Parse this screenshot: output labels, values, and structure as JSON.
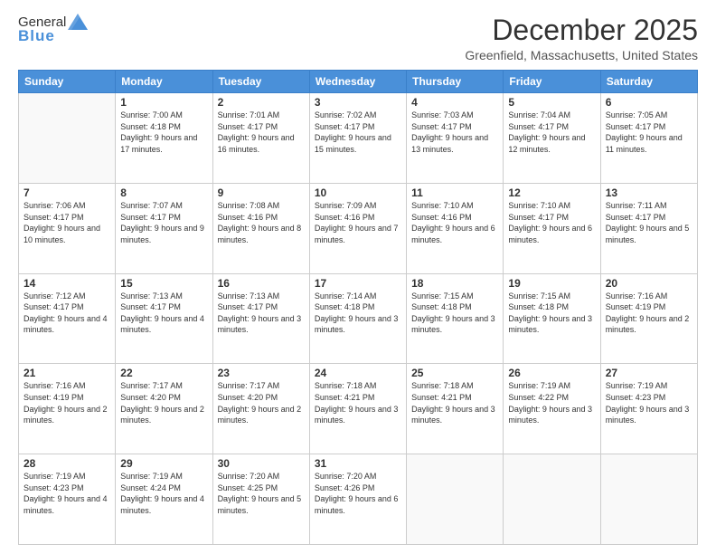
{
  "logo": {
    "general": "General",
    "blue": "Blue"
  },
  "header": {
    "month": "December 2025",
    "location": "Greenfield, Massachusetts, United States"
  },
  "weekdays": [
    "Sunday",
    "Monday",
    "Tuesday",
    "Wednesday",
    "Thursday",
    "Friday",
    "Saturday"
  ],
  "weeks": [
    [
      {
        "day": "",
        "sunrise": "",
        "sunset": "",
        "daylight": ""
      },
      {
        "day": "1",
        "sunrise": "Sunrise: 7:00 AM",
        "sunset": "Sunset: 4:18 PM",
        "daylight": "Daylight: 9 hours and 17 minutes."
      },
      {
        "day": "2",
        "sunrise": "Sunrise: 7:01 AM",
        "sunset": "Sunset: 4:17 PM",
        "daylight": "Daylight: 9 hours and 16 minutes."
      },
      {
        "day": "3",
        "sunrise": "Sunrise: 7:02 AM",
        "sunset": "Sunset: 4:17 PM",
        "daylight": "Daylight: 9 hours and 15 minutes."
      },
      {
        "day": "4",
        "sunrise": "Sunrise: 7:03 AM",
        "sunset": "Sunset: 4:17 PM",
        "daylight": "Daylight: 9 hours and 13 minutes."
      },
      {
        "day": "5",
        "sunrise": "Sunrise: 7:04 AM",
        "sunset": "Sunset: 4:17 PM",
        "daylight": "Daylight: 9 hours and 12 minutes."
      },
      {
        "day": "6",
        "sunrise": "Sunrise: 7:05 AM",
        "sunset": "Sunset: 4:17 PM",
        "daylight": "Daylight: 9 hours and 11 minutes."
      }
    ],
    [
      {
        "day": "7",
        "sunrise": "Sunrise: 7:06 AM",
        "sunset": "Sunset: 4:17 PM",
        "daylight": "Daylight: 9 hours and 10 minutes."
      },
      {
        "day": "8",
        "sunrise": "Sunrise: 7:07 AM",
        "sunset": "Sunset: 4:17 PM",
        "daylight": "Daylight: 9 hours and 9 minutes."
      },
      {
        "day": "9",
        "sunrise": "Sunrise: 7:08 AM",
        "sunset": "Sunset: 4:16 PM",
        "daylight": "Daylight: 9 hours and 8 minutes."
      },
      {
        "day": "10",
        "sunrise": "Sunrise: 7:09 AM",
        "sunset": "Sunset: 4:16 PM",
        "daylight": "Daylight: 9 hours and 7 minutes."
      },
      {
        "day": "11",
        "sunrise": "Sunrise: 7:10 AM",
        "sunset": "Sunset: 4:16 PM",
        "daylight": "Daylight: 9 hours and 6 minutes."
      },
      {
        "day": "12",
        "sunrise": "Sunrise: 7:10 AM",
        "sunset": "Sunset: 4:17 PM",
        "daylight": "Daylight: 9 hours and 6 minutes."
      },
      {
        "day": "13",
        "sunrise": "Sunrise: 7:11 AM",
        "sunset": "Sunset: 4:17 PM",
        "daylight": "Daylight: 9 hours and 5 minutes."
      }
    ],
    [
      {
        "day": "14",
        "sunrise": "Sunrise: 7:12 AM",
        "sunset": "Sunset: 4:17 PM",
        "daylight": "Daylight: 9 hours and 4 minutes."
      },
      {
        "day": "15",
        "sunrise": "Sunrise: 7:13 AM",
        "sunset": "Sunset: 4:17 PM",
        "daylight": "Daylight: 9 hours and 4 minutes."
      },
      {
        "day": "16",
        "sunrise": "Sunrise: 7:13 AM",
        "sunset": "Sunset: 4:17 PM",
        "daylight": "Daylight: 9 hours and 3 minutes."
      },
      {
        "day": "17",
        "sunrise": "Sunrise: 7:14 AM",
        "sunset": "Sunset: 4:18 PM",
        "daylight": "Daylight: 9 hours and 3 minutes."
      },
      {
        "day": "18",
        "sunrise": "Sunrise: 7:15 AM",
        "sunset": "Sunset: 4:18 PM",
        "daylight": "Daylight: 9 hours and 3 minutes."
      },
      {
        "day": "19",
        "sunrise": "Sunrise: 7:15 AM",
        "sunset": "Sunset: 4:18 PM",
        "daylight": "Daylight: 9 hours and 3 minutes."
      },
      {
        "day": "20",
        "sunrise": "Sunrise: 7:16 AM",
        "sunset": "Sunset: 4:19 PM",
        "daylight": "Daylight: 9 hours and 2 minutes."
      }
    ],
    [
      {
        "day": "21",
        "sunrise": "Sunrise: 7:16 AM",
        "sunset": "Sunset: 4:19 PM",
        "daylight": "Daylight: 9 hours and 2 minutes."
      },
      {
        "day": "22",
        "sunrise": "Sunrise: 7:17 AM",
        "sunset": "Sunset: 4:20 PM",
        "daylight": "Daylight: 9 hours and 2 minutes."
      },
      {
        "day": "23",
        "sunrise": "Sunrise: 7:17 AM",
        "sunset": "Sunset: 4:20 PM",
        "daylight": "Daylight: 9 hours and 2 minutes."
      },
      {
        "day": "24",
        "sunrise": "Sunrise: 7:18 AM",
        "sunset": "Sunset: 4:21 PM",
        "daylight": "Daylight: 9 hours and 3 minutes."
      },
      {
        "day": "25",
        "sunrise": "Sunrise: 7:18 AM",
        "sunset": "Sunset: 4:21 PM",
        "daylight": "Daylight: 9 hours and 3 minutes."
      },
      {
        "day": "26",
        "sunrise": "Sunrise: 7:19 AM",
        "sunset": "Sunset: 4:22 PM",
        "daylight": "Daylight: 9 hours and 3 minutes."
      },
      {
        "day": "27",
        "sunrise": "Sunrise: 7:19 AM",
        "sunset": "Sunset: 4:23 PM",
        "daylight": "Daylight: 9 hours and 3 minutes."
      }
    ],
    [
      {
        "day": "28",
        "sunrise": "Sunrise: 7:19 AM",
        "sunset": "Sunset: 4:23 PM",
        "daylight": "Daylight: 9 hours and 4 minutes."
      },
      {
        "day": "29",
        "sunrise": "Sunrise: 7:19 AM",
        "sunset": "Sunset: 4:24 PM",
        "daylight": "Daylight: 9 hours and 4 minutes."
      },
      {
        "day": "30",
        "sunrise": "Sunrise: 7:20 AM",
        "sunset": "Sunset: 4:25 PM",
        "daylight": "Daylight: 9 hours and 5 minutes."
      },
      {
        "day": "31",
        "sunrise": "Sunrise: 7:20 AM",
        "sunset": "Sunset: 4:26 PM",
        "daylight": "Daylight: 9 hours and 6 minutes."
      },
      {
        "day": "",
        "sunrise": "",
        "sunset": "",
        "daylight": ""
      },
      {
        "day": "",
        "sunrise": "",
        "sunset": "",
        "daylight": ""
      },
      {
        "day": "",
        "sunrise": "",
        "sunset": "",
        "daylight": ""
      }
    ]
  ]
}
